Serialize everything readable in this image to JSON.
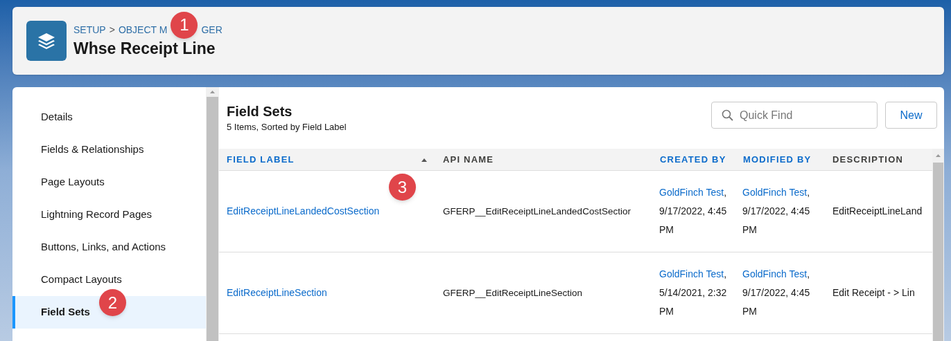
{
  "header": {
    "breadcrumb": [
      {
        "label": "SETUP"
      },
      {
        "label": "OBJECT M",
        "label_after_callout": "GER"
      }
    ],
    "separator": ">",
    "title": "Whse Receipt Line"
  },
  "sidebar": {
    "items": [
      {
        "label": "Details",
        "selected": false
      },
      {
        "label": "Fields & Relationships",
        "selected": false
      },
      {
        "label": "Page Layouts",
        "selected": false
      },
      {
        "label": "Lightning Record Pages",
        "selected": false
      },
      {
        "label": "Buttons, Links, and Actions",
        "selected": false
      },
      {
        "label": "Compact Layouts",
        "selected": false
      },
      {
        "label": "Field Sets",
        "selected": true
      }
    ]
  },
  "content": {
    "title": "Field Sets",
    "subtitle": "5 Items, Sorted by Field Label",
    "search": {
      "placeholder": "Quick Find"
    },
    "new_button": "New"
  },
  "table": {
    "columns": [
      {
        "label": "FIELD LABEL",
        "sortable": true,
        "sorted": true
      },
      {
        "label": "API NAME",
        "sortable": false,
        "sorted": false
      },
      {
        "label": "CREATED BY",
        "sortable": true,
        "sorted": false
      },
      {
        "label": "MODIFIED BY",
        "sortable": true,
        "sorted": false
      },
      {
        "label": "DESCRIPTION",
        "sortable": false,
        "sorted": false
      }
    ],
    "rows": [
      {
        "field_label": "EditReceiptLineLandedCostSection",
        "api_name": "GFERP__EditReceiptLineLandedCostSectior",
        "created_by": {
          "user": "GoldFinch Test",
          "rest": ", 9/17/2022, 4:45 PM"
        },
        "modified_by": {
          "user": "GoldFinch Test",
          "rest": ", 9/17/2022, 4:45 PM"
        },
        "description": "EditReceiptLineLand"
      },
      {
        "field_label": "EditReceiptLineSection",
        "api_name": "GFERP__EditReceiptLineSection",
        "created_by": {
          "user": "GoldFinch Test",
          "rest": ", 5/14/2021, 2:32 PM"
        },
        "modified_by": {
          "user": "GoldFinch Test",
          "rest": ", 9/17/2022, 4:45 PM"
        },
        "description": "Edit Receipt - > Lin"
      }
    ]
  },
  "callouts": [
    {
      "label": "1"
    },
    {
      "label": "2"
    },
    {
      "label": "3"
    }
  ]
}
